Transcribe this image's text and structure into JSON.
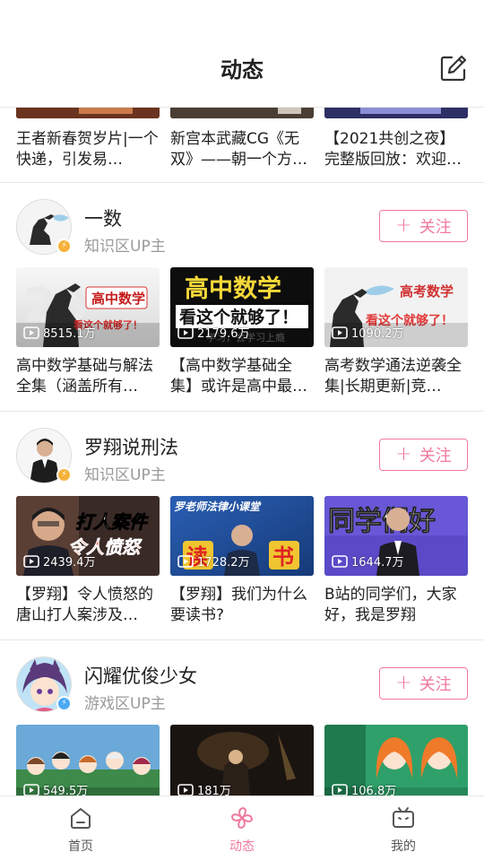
{
  "header": {
    "title": "动态",
    "edit_icon": "edit-icon"
  },
  "top_videos": [
    {
      "title": "王者新春贺岁片|一个快递，引发易…"
    },
    {
      "title": "新宫本武藏CG《无双》——朝一个方…"
    },
    {
      "title": "【2021共创之夜】完整版回放：欢迎…"
    }
  ],
  "follow_label": "关注",
  "uploaders": [
    {
      "name": "一数",
      "category": "知识区UP主",
      "badge_color": "#f5b23a",
      "videos": [
        {
          "plays": "8515.1万",
          "title": "高中数学基础与解法全集（涵盖所有…",
          "overlay_a": "高中数学",
          "overlay_b": "看这个就够了！"
        },
        {
          "plays": "2179.6万",
          "title": "【高中数学基础全集】或许是高中最…",
          "overlay_a": "高中数学",
          "overlay_b": "看这个就够了！",
          "overlay_c": "学习，会学习上瘾"
        },
        {
          "plays": "1090.2万",
          "title": "高考数学通法逆袭全集|长期更新|竞…",
          "overlay_a": "高考数学",
          "overlay_b": "看这个就够了！"
        }
      ]
    },
    {
      "name": "罗翔说刑法",
      "category": "知识区UP主",
      "badge_color": "#f5b23a",
      "videos": [
        {
          "plays": "2439.4万",
          "title": "【罗翔】令人愤怒的唐山打人案涉及…",
          "overlay_a": "打人案件",
          "overlay_b": "令人愤怒"
        },
        {
          "plays": "1728.2万",
          "title": "【罗翔】我们为什么要读书?",
          "overlay_a": "罗老师法律小课堂",
          "overlay_b": "读",
          "overlay_c": "书"
        },
        {
          "plays": "1644.7万",
          "title": "B站的同学们，大家好，我是罗翔",
          "overlay_a": "同学们好"
        }
      ]
    },
    {
      "name": "闪耀优俊少女",
      "category": "游戏区UP主",
      "badge_color": "#4aa9f5",
      "videos": [
        {
          "plays": "549.5万",
          "title": ""
        },
        {
          "plays": "181万",
          "title": ""
        },
        {
          "plays": "106.8万",
          "title": ""
        }
      ]
    }
  ],
  "tabbar": [
    {
      "label": "首页",
      "icon": "home-icon"
    },
    {
      "label": "动态",
      "icon": "pinwheel-icon"
    },
    {
      "label": "我的",
      "icon": "tv-icon"
    }
  ],
  "colors": {
    "accent": "#f07a9d",
    "divider": "#e7e7e7",
    "text": "#212121",
    "muted": "#9a9a9a"
  }
}
